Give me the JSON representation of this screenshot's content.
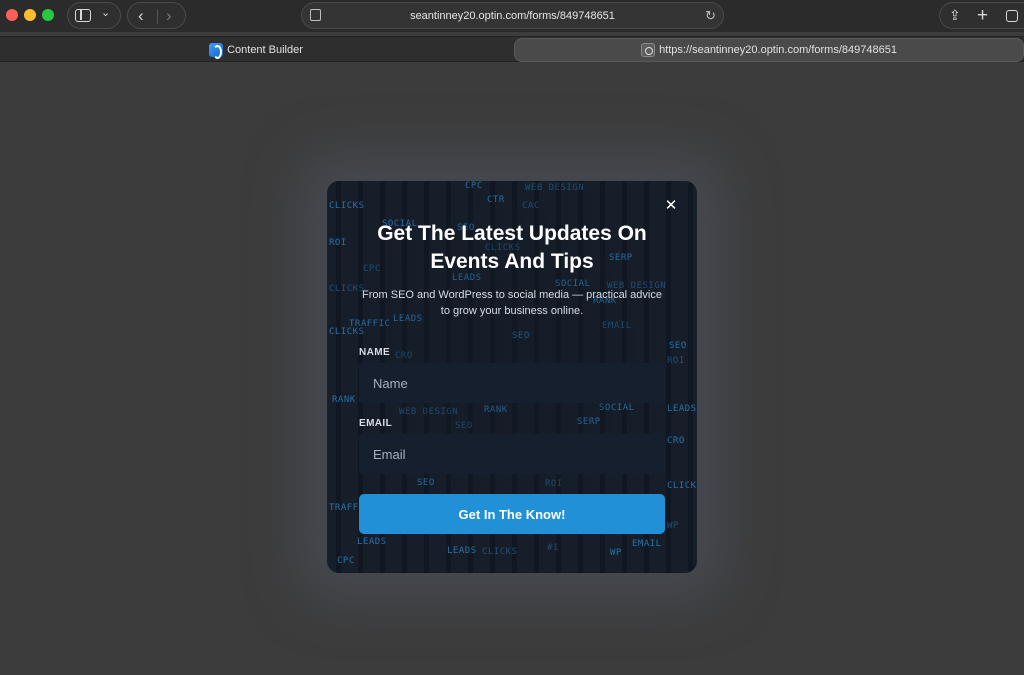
{
  "browser": {
    "url_display": "seantinney20.optin.com/forms/849748651",
    "icons": {
      "sidebar": "sidebar-icon",
      "tab_overview": "chevron-down-icon",
      "back": "chevron-left-icon",
      "forward": "chevron-right-icon",
      "page_menu": "page-settings-icon",
      "reload": "reload-icon",
      "share": "share-icon",
      "new_tab": "plus-icon",
      "tab_overview_grid": "tabs-overview-icon"
    },
    "tabs": [
      {
        "label": "Content Builder",
        "active": false,
        "favicon": "content-builder-favicon"
      },
      {
        "label": "https://seantinney20.optin.com/forms/849748651",
        "active": true,
        "favicon": "site-favicon"
      }
    ]
  },
  "popup": {
    "title": "Get The Latest Updates On Events And Tips",
    "subtitle": "From SEO and WordPress to social media — practical advice to grow your business online.",
    "close_icon": "close-icon",
    "fields": {
      "name_label": "NAME",
      "name_placeholder": "Name",
      "email_label": "EMAIL",
      "email_placeholder": "Email"
    },
    "submit_label": "Get In The Know!",
    "background_words": [
      "WEB DESIGN",
      "CPC",
      "CTR",
      "CAC",
      "CLICKS",
      "SOCIAL",
      "SEO",
      "ROI",
      "SERP",
      "LEADS",
      "TRAFFIC",
      "RANK",
      "EMAIL",
      "CRO",
      "WP",
      "#1"
    ],
    "colors": {
      "accent": "#2190d6",
      "card_background": "#121a26",
      "field_background": "#161f2e"
    }
  }
}
